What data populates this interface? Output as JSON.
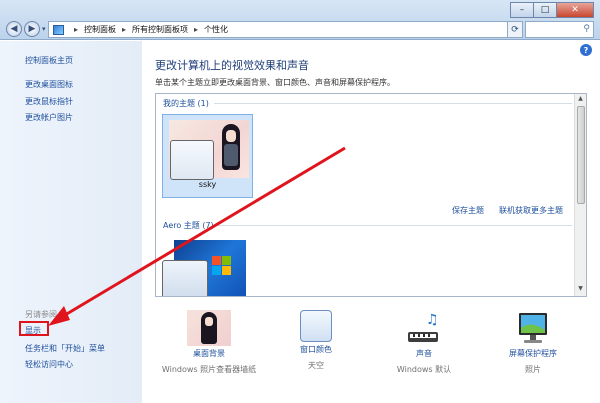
{
  "window": {
    "minimize": "–",
    "maximize": "□",
    "close": "✕"
  },
  "address": {
    "crumbs": [
      "控制面板",
      "所有控制面板项",
      "个性化"
    ],
    "sep": "▸"
  },
  "left": {
    "home": "控制面板主页",
    "links": [
      "更改桌面图标",
      "更改鼠标指针",
      "更改帐户图片"
    ],
    "see_also": "另请参阅",
    "display": "显示",
    "taskbar": "任务栏和「开始」菜单",
    "ease": "轻松访问中心"
  },
  "main": {
    "help": "?",
    "title": "更改计算机上的视觉效果和声音",
    "subtitle": "单击某个主题立即更改桌面背景、窗口颜色、声音和屏幕保护程序。",
    "my_themes_header": "我的主题 (1)",
    "theme_name": "ssky",
    "save_theme": "保存主题",
    "get_more": "联机获取更多主题",
    "aero_header": "Aero 主题 (7)"
  },
  "bottom": [
    {
      "label": "桌面背景",
      "sub": "Windows 照片查看器墙纸"
    },
    {
      "label": "窗口颜色",
      "sub": "天空"
    },
    {
      "label": "声音",
      "sub": "Windows 默认"
    },
    {
      "label": "屏幕保护程序",
      "sub": "照片"
    }
  ],
  "colors": {
    "link": "#1e4f9b",
    "annotation": "#e0141c"
  }
}
